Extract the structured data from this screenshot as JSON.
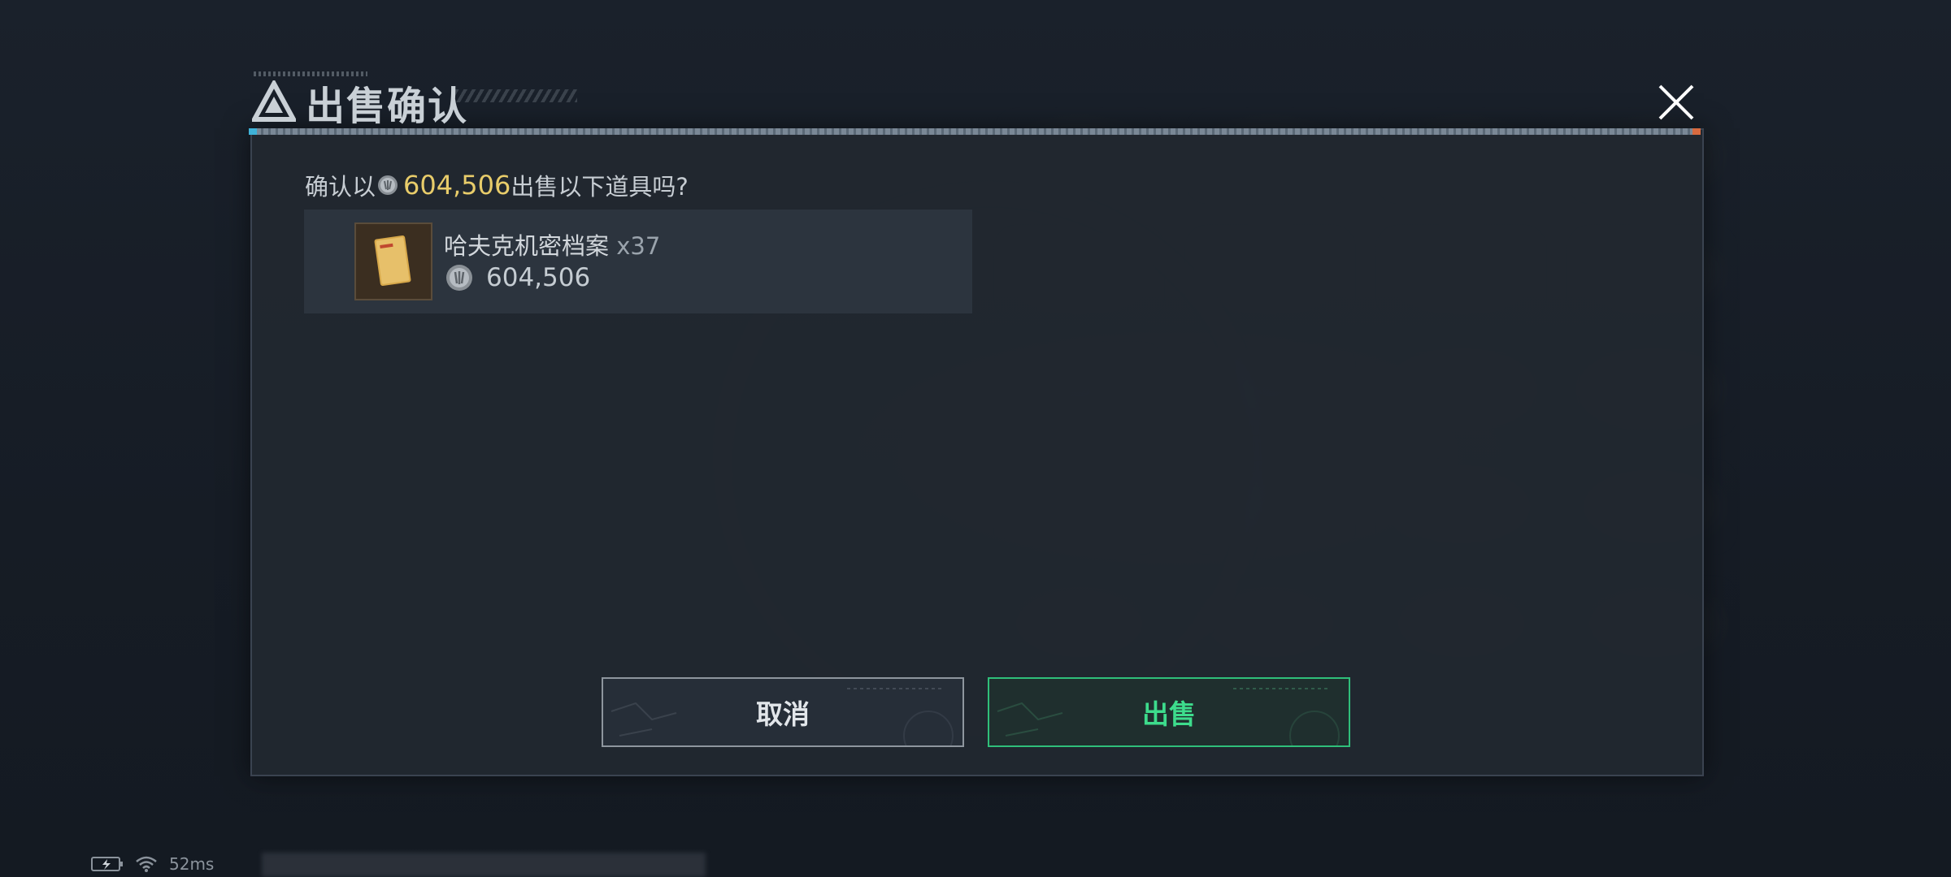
{
  "dialog": {
    "title": "出售确认",
    "confirm_prefix": "确认以",
    "confirm_amount": "604,506",
    "confirm_suffix": "出售以下道具吗?"
  },
  "item": {
    "name": "哈夫克机密档案",
    "quantity": "x37",
    "price": "604,506"
  },
  "buttons": {
    "cancel_label": "取消",
    "sell_label": "出售"
  },
  "status": {
    "ping": "52ms"
  },
  "icons": {
    "title": "triangle-logo-icon",
    "close": "close-icon",
    "coin": "coin-icon",
    "item": "document-icon",
    "battery": "battery-charging-icon",
    "wifi": "wifi-icon"
  },
  "colors": {
    "amount_gold": "#e8cc6a",
    "sell_green": "#2fbf7a",
    "cancel_border": "#8e969e"
  }
}
